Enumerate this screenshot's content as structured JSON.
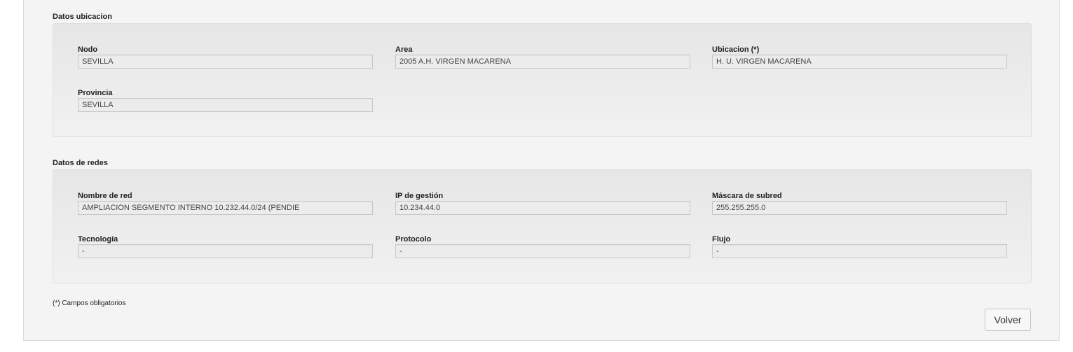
{
  "ubicacion": {
    "title": "Datos ubicacion",
    "fields": {
      "nodo": {
        "label": "Nodo",
        "value": "SEVILLA"
      },
      "area": {
        "label": "Area",
        "value": "2005 A.H. VIRGEN MACARENA"
      },
      "ubicacion": {
        "label": "Ubicacion (*)",
        "value": "H. U. VIRGEN MACARENA"
      },
      "provincia": {
        "label": "Provincia",
        "value": "SEVILLA"
      }
    }
  },
  "redes": {
    "title": "Datos de redes",
    "fields": {
      "nombre_red": {
        "label": "Nombre de red",
        "value": "AMPLIACIÓN SEGMENTO INTERNO 10.232.44.0/24 (PENDIE"
      },
      "ip_gestion": {
        "label": "IP de gestión",
        "value": "10.234.44.0"
      },
      "mascara": {
        "label": "Máscara de subred",
        "value": "255.255.255.0"
      },
      "tecnologia": {
        "label": "Tecnología",
        "value": "-"
      },
      "protocolo": {
        "label": "Protocolo",
        "value": "-"
      },
      "flujo": {
        "label": "Flujo",
        "value": "-"
      }
    }
  },
  "footnote": "(*) Campos obligatorios",
  "buttons": {
    "volver": "Volver"
  }
}
